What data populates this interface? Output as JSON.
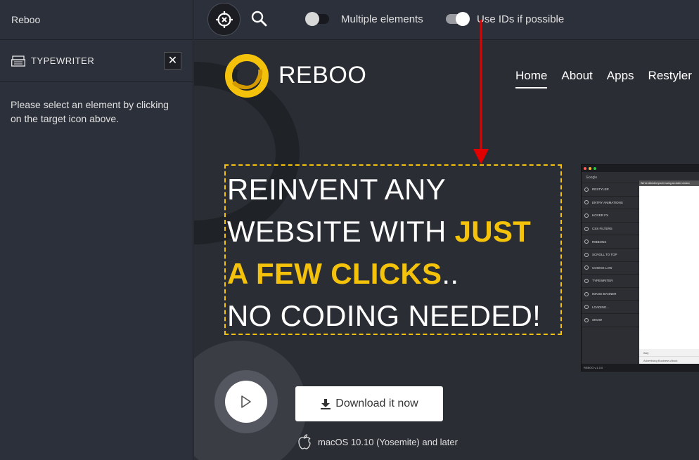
{
  "sidebar": {
    "app_title": "Reboo",
    "section_title": "TYPEWRITER",
    "close_label": "✕",
    "message": "Please select an element by clicking on the target icon above."
  },
  "toolbar": {
    "toggles": [
      {
        "label": "Multiple elements",
        "on": false
      },
      {
        "label": "Use IDs if possible",
        "on": true
      }
    ]
  },
  "site": {
    "brand": "REBOO",
    "nav": [
      "Home",
      "About",
      "Apps",
      "Restyler"
    ],
    "active_nav": "Home",
    "hero": {
      "line1": "REINVENT ANY",
      "line2_plain": "WEBSITE WITH ",
      "line2_highlight": "JUST",
      "line3_highlight": "A FEW CLICKS",
      "line3_plain": "..",
      "line4": "NO CODING NEEDED!"
    },
    "download_label": "Download it now",
    "os_requirement": "macOS 10.10 (Yosemite) and later",
    "accent_color": "#f5c20b"
  },
  "mockup": {
    "header": "Google",
    "banner": "We've detected you're using an older version",
    "items": [
      "RESTYLER",
      "ENTRY ANIMATIONS",
      "HOVER FX",
      "CSS FILTERS",
      "RIBBONS",
      "SCROLL TO TOP",
      "COOKIE LAW",
      "TYPEWRITER",
      "IMAGE BANNER",
      "LOADING...",
      "SNOW"
    ],
    "country": "Italy",
    "links": "Advertising   Business   About",
    "footer": "REBOO v.1.0.0"
  }
}
